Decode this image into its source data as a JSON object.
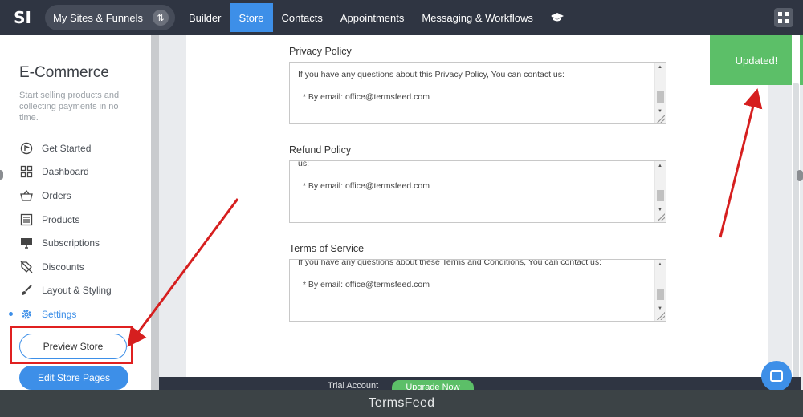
{
  "topnav": {
    "logo": "SI",
    "sites_label": "My Sites & Funnels",
    "items": [
      "Builder",
      "Store",
      "Contacts",
      "Appointments",
      "Messaging & Workflows"
    ],
    "active": "Store"
  },
  "sidebar": {
    "title": "E-Commerce",
    "description": "Start selling products and collecting payments in no time.",
    "items": [
      {
        "label": "Get Started",
        "icon": "rocket-icon"
      },
      {
        "label": "Dashboard",
        "icon": "dashboard-icon"
      },
      {
        "label": "Orders",
        "icon": "basket-icon"
      },
      {
        "label": "Products",
        "icon": "list-icon"
      },
      {
        "label": "Subscriptions",
        "icon": "monitor-icon"
      },
      {
        "label": "Discounts",
        "icon": "tag-icon"
      },
      {
        "label": "Layout & Styling",
        "icon": "brush-icon"
      },
      {
        "label": "Settings",
        "icon": "gear-icon"
      }
    ],
    "active": "Settings",
    "preview_label": "Preview Store",
    "edit_label": "Edit Store Pages"
  },
  "policies": {
    "privacy": {
      "label": "Privacy Policy",
      "text": "If you have any questions about this Privacy Policy, You can contact us:\n\n  * By email: office@termsfeed.com"
    },
    "refund": {
      "label": "Refund Policy",
      "text": "us:\n\n  * By email: office@termsfeed.com"
    },
    "terms": {
      "label": "Terms of Service",
      "text": "If you have any questions about these Terms and Conditions, You can contact us:\n\n  * By email: office@termsfeed.com"
    }
  },
  "toast": {
    "message": "Updated!"
  },
  "bottom_bar": {
    "trial_label": "Trial Account",
    "upgrade_label": "Upgrade Now"
  },
  "footer": {
    "brand": "TermsFeed"
  },
  "colors": {
    "nav_bg": "#2f3542",
    "accent": "#3d8fe8",
    "success": "#5cbf68",
    "highlight": "#e02020"
  }
}
